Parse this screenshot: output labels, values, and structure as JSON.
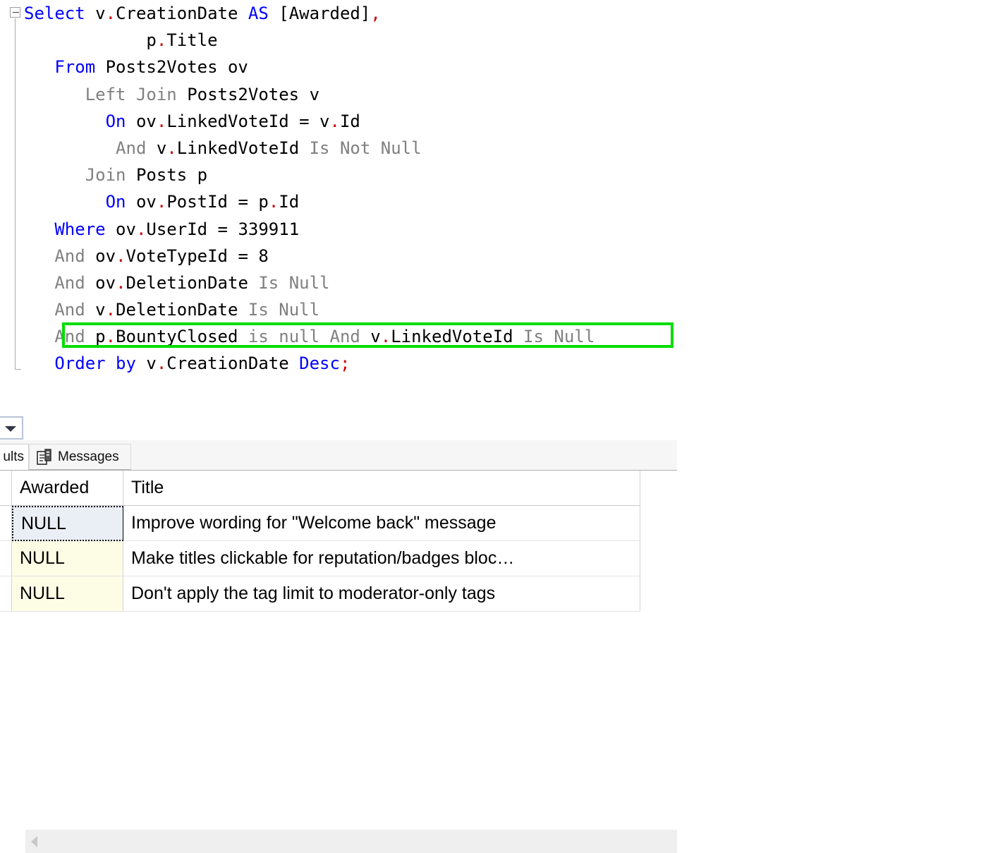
{
  "editor": {
    "fold_marker": "collapse-minus",
    "lines": [
      [
        {
          "t": "Select ",
          "c": "kw"
        },
        {
          "t": "v",
          "c": ""
        },
        {
          "t": ".",
          "c": "punct"
        },
        {
          "t": "CreationDate ",
          "c": ""
        },
        {
          "t": "AS ",
          "c": "kw"
        },
        {
          "t": "[Awarded]",
          "c": ""
        },
        {
          "t": ",",
          "c": "punct"
        }
      ],
      [
        {
          "t": "            p",
          "c": ""
        },
        {
          "t": ".",
          "c": "punct"
        },
        {
          "t": "Title",
          "c": ""
        }
      ],
      [
        {
          "t": "   From ",
          "c": "kw"
        },
        {
          "t": "Posts2Votes ov",
          "c": ""
        }
      ],
      [
        {
          "t": "      Left Join ",
          "c": "kwg"
        },
        {
          "t": "Posts2Votes v",
          "c": ""
        }
      ],
      [
        {
          "t": "        On ",
          "c": "kw"
        },
        {
          "t": "ov",
          "c": ""
        },
        {
          "t": ".",
          "c": "punct"
        },
        {
          "t": "LinkedVoteId = v",
          "c": ""
        },
        {
          "t": ".",
          "c": "punct"
        },
        {
          "t": "Id",
          "c": ""
        }
      ],
      [
        {
          "t": "         And ",
          "c": "kwg"
        },
        {
          "t": "v",
          "c": ""
        },
        {
          "t": ".",
          "c": "punct"
        },
        {
          "t": "LinkedVoteId ",
          "c": ""
        },
        {
          "t": "Is Not Null",
          "c": "kwg"
        }
      ],
      [
        {
          "t": "      Join ",
          "c": "kwg"
        },
        {
          "t": "Posts p",
          "c": ""
        }
      ],
      [
        {
          "t": "        On ",
          "c": "kw"
        },
        {
          "t": "ov",
          "c": ""
        },
        {
          "t": ".",
          "c": "punct"
        },
        {
          "t": "PostId = p",
          "c": ""
        },
        {
          "t": ".",
          "c": "punct"
        },
        {
          "t": "Id",
          "c": ""
        }
      ],
      [
        {
          "t": "   Where ",
          "c": "kw"
        },
        {
          "t": "ov",
          "c": ""
        },
        {
          "t": ".",
          "c": "punct"
        },
        {
          "t": "UserId = 339911",
          "c": ""
        }
      ],
      [
        {
          "t": "   And ",
          "c": "kwg"
        },
        {
          "t": "ov",
          "c": ""
        },
        {
          "t": ".",
          "c": "punct"
        },
        {
          "t": "VoteTypeId = 8",
          "c": ""
        }
      ],
      [
        {
          "t": "   And ",
          "c": "kwg"
        },
        {
          "t": "ov",
          "c": ""
        },
        {
          "t": ".",
          "c": "punct"
        },
        {
          "t": "DeletionDate ",
          "c": ""
        },
        {
          "t": "Is Null",
          "c": "kwg"
        }
      ],
      [
        {
          "t": "   And ",
          "c": "kwg"
        },
        {
          "t": "v",
          "c": ""
        },
        {
          "t": ".",
          "c": "punct"
        },
        {
          "t": "DeletionDate ",
          "c": ""
        },
        {
          "t": "Is Null",
          "c": "kwg"
        }
      ],
      [
        {
          "t": "   And ",
          "c": "kwg"
        },
        {
          "t": "p",
          "c": ""
        },
        {
          "t": ".",
          "c": "punct"
        },
        {
          "t": "BountyClosed ",
          "c": ""
        },
        {
          "t": "is null And ",
          "c": "kwg"
        },
        {
          "t": "v",
          "c": ""
        },
        {
          "t": ".",
          "c": "punct"
        },
        {
          "t": "LinkedVoteId ",
          "c": ""
        },
        {
          "t": "Is Null",
          "c": "kwg"
        }
      ],
      [
        {
          "t": "   Order by ",
          "c": "kw"
        },
        {
          "t": "v",
          "c": ""
        },
        {
          "t": ".",
          "c": "punct"
        },
        {
          "t": "CreationDate ",
          "c": ""
        },
        {
          "t": "Desc",
          "c": "kw"
        },
        {
          "t": ";",
          "c": "punct"
        }
      ]
    ],
    "annotation": {
      "type": "rectangle-highlight",
      "color": "#00dd00",
      "target_line_text": "And p.BountyClosed is null And v.LinkedVoteId Is Null"
    }
  },
  "toolbar": {
    "dropdown_label": "",
    "scroll_left_label": ""
  },
  "tabs": [
    {
      "label": "ults",
      "full_label": "Results",
      "icon": "grid-icon",
      "active": true
    },
    {
      "label": "Messages",
      "icon": "messages-icon",
      "active": false
    }
  ],
  "grid": {
    "columns": [
      "Awarded",
      "Title"
    ],
    "rows": [
      {
        "Awarded": "NULL",
        "Title": "Improve wording for \"Welcome back\" message",
        "selected": true
      },
      {
        "Awarded": "NULL",
        "Title": "Make titles clickable for reputation/badges bloc…",
        "selected": false
      },
      {
        "Awarded": "NULL",
        "Title": "Don't apply the tag limit to moderator-only tags",
        "selected": false
      }
    ]
  },
  "colors": {
    "keyword_blue": "#0000ff",
    "keyword_gray": "#808080",
    "punct_red": "#cc0000",
    "highlight_green": "#00dd00",
    "selected_row": "#eaeef5",
    "alt_row": "#fdfde6"
  }
}
